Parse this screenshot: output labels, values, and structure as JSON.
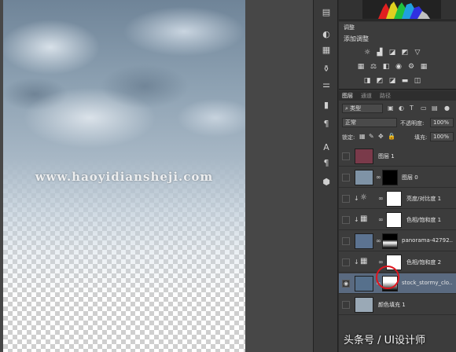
{
  "canvas": {
    "watermark": "www.haoyidiansheji.com"
  },
  "tool_strip": {
    "icons": [
      "histogram-icon",
      "info-icon",
      "adjust-icon",
      "layer-comp-icon",
      "brush-icon",
      "tool-preset-icon",
      "paragraph-icon",
      "character-icon",
      "paragraph-style-icon",
      "3d-icon"
    ]
  },
  "adjustments_panel": {
    "tab": "调整",
    "subtitle": "添加调整"
  },
  "layers_panel": {
    "tabs": [
      "图层",
      "通道",
      "路径"
    ],
    "filter_kind": "类型",
    "blend_mode": "正常",
    "opacity_label": "不透明度:",
    "opacity_value": "100%",
    "lock_label": "锁定:",
    "fill_label": "填充:",
    "fill_value": "100%",
    "layers": [
      {
        "name": "图层 1",
        "type": "pixel",
        "thumb": "#7a3a4a",
        "visible": false
      },
      {
        "name": "图层 0",
        "type": "pixel-mask",
        "thumb": "#7f93a6",
        "visible": false
      },
      {
        "name": "亮度/对比度 1",
        "type": "adjustment",
        "visible": false
      },
      {
        "name": "色相/饱和度 1",
        "type": "adjustment",
        "visible": false
      },
      {
        "name": "panorama-42792...",
        "type": "pixel-mask",
        "thumb": "#5c7391",
        "visible": false
      },
      {
        "name": "色相/饱和度 2",
        "type": "adjustment",
        "visible": false
      },
      {
        "name": "stock_stormy_clo...",
        "type": "pixel-mask",
        "thumb": "#56708c",
        "visible": true,
        "selected": true
      },
      {
        "name": "颜色填充 1",
        "type": "fill",
        "thumb": "#9aa9b6",
        "visible": false
      }
    ]
  },
  "credit": "头条号 / UI设计师",
  "colors": {
    "highlight_circle": "#e0141e",
    "selected_row": "#5a6a80"
  }
}
